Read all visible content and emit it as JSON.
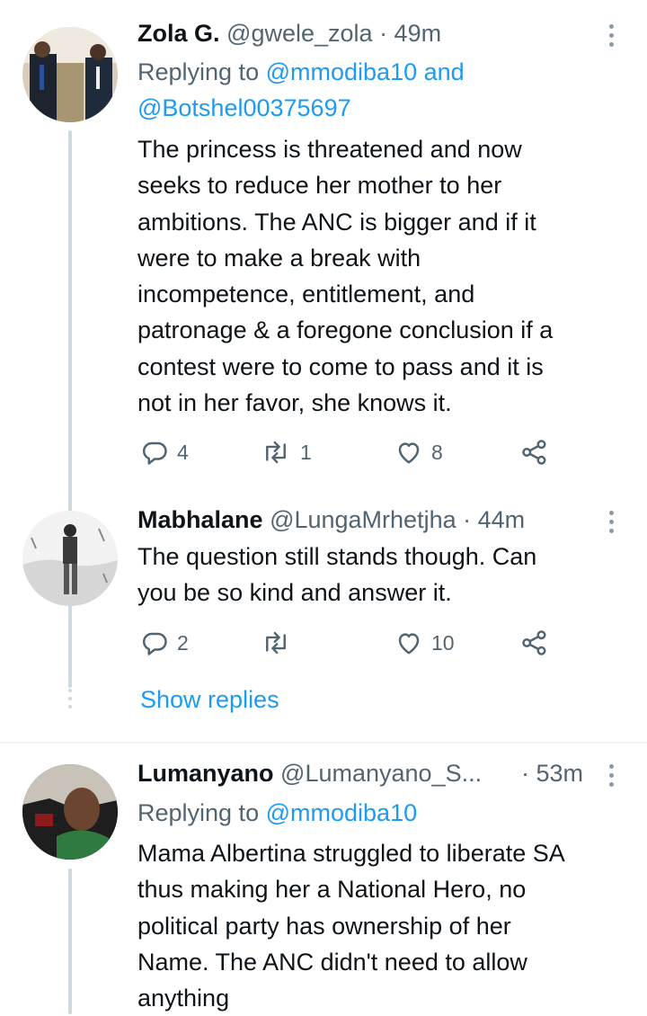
{
  "tweets": [
    {
      "name": "Zola G.",
      "handle": "@gwele_zola",
      "time": "· 49m",
      "replying_label": "Replying to",
      "replying_mentions": [
        "@mmodiba10",
        "@Botshel00375697"
      ],
      "replying_joiner": "and",
      "text_lines": [
        "The princess is threatened and now",
        "seeks to reduce her mother to her",
        "ambitions. The ANC is bigger and if it",
        "were to make a break with",
        "incompetence, entitlement, and",
        "patronage & a foregone conclusion if a",
        "contest were to come to pass and it is",
        "not in her favor, she knows it."
      ],
      "replies": "4",
      "retweets": "1",
      "likes": "8"
    },
    {
      "name": "Mabhalane",
      "handle": "@LungaMrhetjha",
      "time": "· 44m",
      "text_lines": [
        "The question still stands though. Can",
        "you be so kind and answer it."
      ],
      "replies": "2",
      "retweets": "",
      "likes": "10"
    },
    {
      "name": "Lumanyano",
      "handle": "@Lumanyano_S...",
      "time": "· 53m",
      "replying_label": "Replying to",
      "replying_mentions": [
        "@mmodiba10"
      ],
      "text_lines": [
        "Mama Albertina struggled to liberate SA",
        "thus making her a National Hero, no",
        "political party has ownership of her",
        "Name. The ANC didn't need to allow",
        "anything"
      ]
    }
  ],
  "show_replies": "Show replies",
  "icons": {
    "reply": "reply-icon",
    "retweet": "retweet-icon",
    "like": "heart-icon",
    "share": "share-icon",
    "more": "more-vertical-icon"
  },
  "colors": {
    "accent": "#1d9bf0",
    "secondary_text": "#536471",
    "thread_line": "#cfd9de"
  }
}
